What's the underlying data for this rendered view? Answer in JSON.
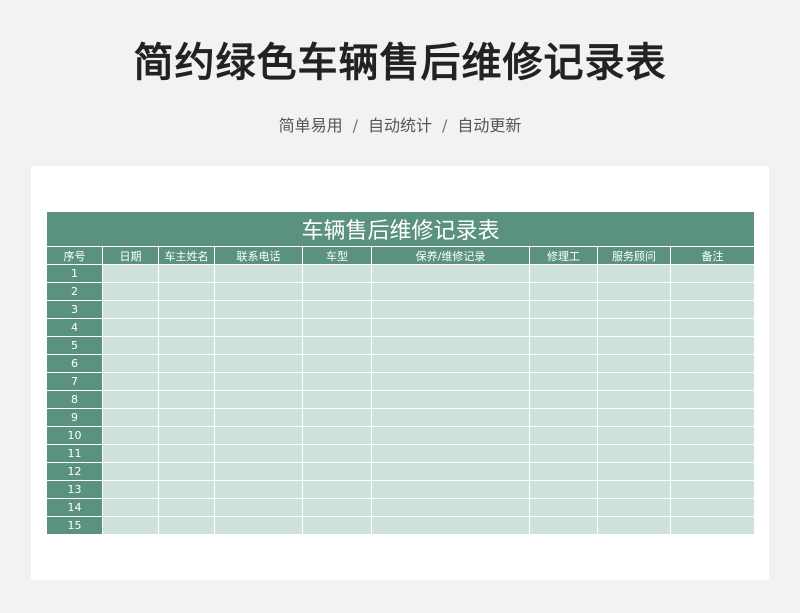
{
  "page": {
    "title": "简约绿色车辆售后维修记录表",
    "subtitle_items": [
      "简单易用",
      "自动统计",
      "自动更新"
    ],
    "subtitle_separator": "/"
  },
  "sheet": {
    "title": "车辆售后维修记录表",
    "headers": [
      "序号",
      "日期",
      "车主姓名",
      "联系电话",
      "车型",
      "保养/维修记录",
      "修理工",
      "服务顾问",
      "备注"
    ],
    "row_numbers": [
      "1",
      "2",
      "3",
      "4",
      "5",
      "6",
      "7",
      "8",
      "9",
      "10",
      "11",
      "12",
      "13",
      "14",
      "15"
    ]
  },
  "colors": {
    "header_green": "#5a9181",
    "cell_green": "#cfe1dc",
    "background": "#f1f2f4"
  }
}
